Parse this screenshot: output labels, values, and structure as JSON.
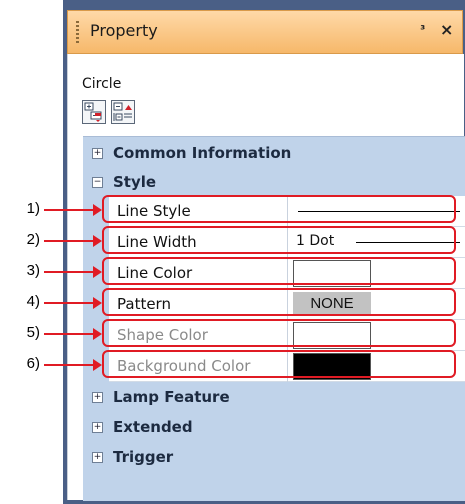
{
  "window": {
    "title": "Property",
    "pin_icon": "pin-icon",
    "close_icon": "close-icon"
  },
  "object_name": "Circle",
  "toolbar": {
    "buttons": [
      "sort-by-category-icon",
      "sort-alphabetical-icon"
    ]
  },
  "categories": [
    {
      "label": "Common Information",
      "expanded": false
    },
    {
      "label": "Style",
      "expanded": true
    },
    {
      "label": "Lamp Feature",
      "expanded": false
    },
    {
      "label": "Extended",
      "expanded": false
    },
    {
      "label": "Trigger",
      "expanded": false
    }
  ],
  "properties": [
    {
      "name": "Line Style",
      "value": "",
      "enabled": true
    },
    {
      "name": "Line Width",
      "value": "1 Dot",
      "enabled": true
    },
    {
      "name": "Line Color",
      "value": "",
      "enabled": true
    },
    {
      "name": "Pattern",
      "value": "NONE",
      "enabled": true
    },
    {
      "name": "Shape Color",
      "value": "",
      "enabled": false
    },
    {
      "name": "Background Color",
      "value": "",
      "enabled": false
    }
  ],
  "callouts": [
    "1)",
    "2)",
    "3)",
    "4)",
    "5)",
    "6)"
  ],
  "colors": {
    "title_bar": "#f6b86a",
    "grid_background": "#c0d3ea",
    "highlight": "#e01b24",
    "background_color_swatch": "#000000",
    "pattern_box": "#c2c2c2"
  }
}
